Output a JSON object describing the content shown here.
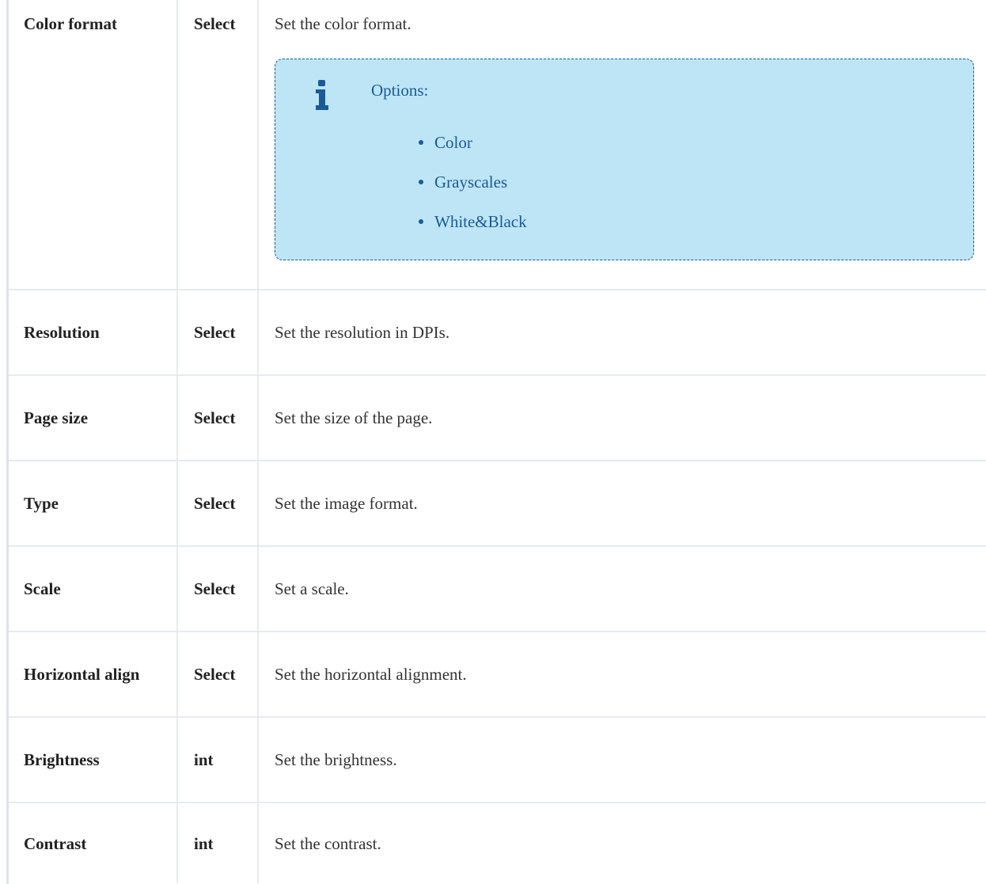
{
  "rows": [
    {
      "name": "Color format",
      "type": "Select",
      "description": "Set the color format.",
      "info": {
        "title": "Options:",
        "items": [
          "Color",
          "Grayscales",
          "White&Black"
        ]
      }
    },
    {
      "name": "Resolution",
      "type": "Select",
      "description": "Set the resolution in DPIs."
    },
    {
      "name": "Page size",
      "type": "Select",
      "description": "Set the size of the page."
    },
    {
      "name": "Type",
      "type": "Select",
      "description": "Set the image format."
    },
    {
      "name": "Scale",
      "type": "Select",
      "description": "Set a scale."
    },
    {
      "name": "Horizontal align",
      "type": "Select",
      "description": "Set the horizontal alignment."
    },
    {
      "name": "Brightness",
      "type": "int",
      "description": "Set the brightness."
    },
    {
      "name": "Contrast",
      "type": "int",
      "description": "Set the contrast."
    }
  ],
  "colors": {
    "info_background": "#bde5f6",
    "info_text": "#1a5a99",
    "grid_line": "#e6ebf2"
  },
  "icons": {
    "info": "info-icon"
  }
}
